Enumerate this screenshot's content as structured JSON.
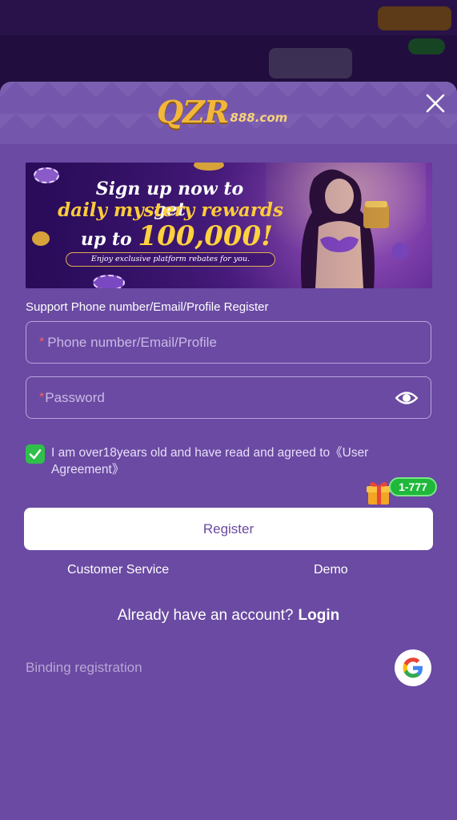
{
  "logo": {
    "main": "QZR",
    "sub": "888.com"
  },
  "banner": {
    "line1": "Sign up now to get",
    "line2": "daily mystery rewards",
    "line3_prefix": "up to ",
    "line3_amount": "100,000!",
    "ribbon": "Enjoy exclusive platform rebates for you."
  },
  "form": {
    "support_label": "Support Phone number/Email/Profile Register",
    "phone_placeholder": "Phone number/Email/Profile",
    "password_placeholder": "Password",
    "required_mark": "*",
    "agreement_checked": true,
    "agreement_text": "I am over18years old and have read and agreed to《User Agreement》",
    "register_label": "Register"
  },
  "gift": {
    "label": "1-777"
  },
  "links": {
    "customer_service": "Customer Service",
    "demo": "Demo",
    "account_prompt": "Already have an account?",
    "login": "Login",
    "binding": "Binding registration"
  },
  "icons": {
    "close": "close-icon",
    "eye": "eye-icon",
    "check": "check-icon",
    "gift": "gift-icon",
    "google": "google-icon"
  },
  "colors": {
    "modal_bg": "#6a4aa2",
    "accent_green": "#2fbf4a",
    "logo_gold": "#f2b73a",
    "required_red": "#ff5d5d"
  }
}
